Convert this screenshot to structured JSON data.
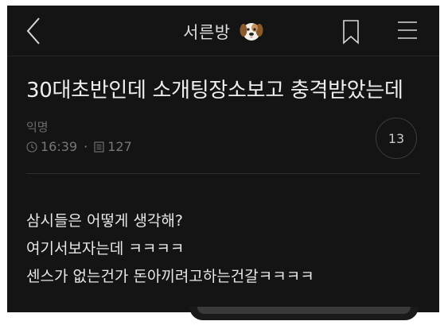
{
  "header": {
    "title": "서른방",
    "icons": [
      "back-chevron-icon",
      "puppy-emoji-icon",
      "bookmark-icon",
      "menu-icon"
    ]
  },
  "post": {
    "title": "30대초반인데 소개팅장소보고 충격받았는데",
    "author": "익명",
    "time": "16:39",
    "views": "127",
    "comment_count": "13",
    "body": [
      "삼시들은 어떻게 생각해?",
      "여기서보자는데 ㅋㅋㅋㅋ",
      "센스가 없는건가 돈아끼려고하는건갈ㅋㅋㅋㅋ"
    ]
  },
  "colors": {
    "background": "#141414",
    "text": "#efefef",
    "muted": "#777777"
  }
}
